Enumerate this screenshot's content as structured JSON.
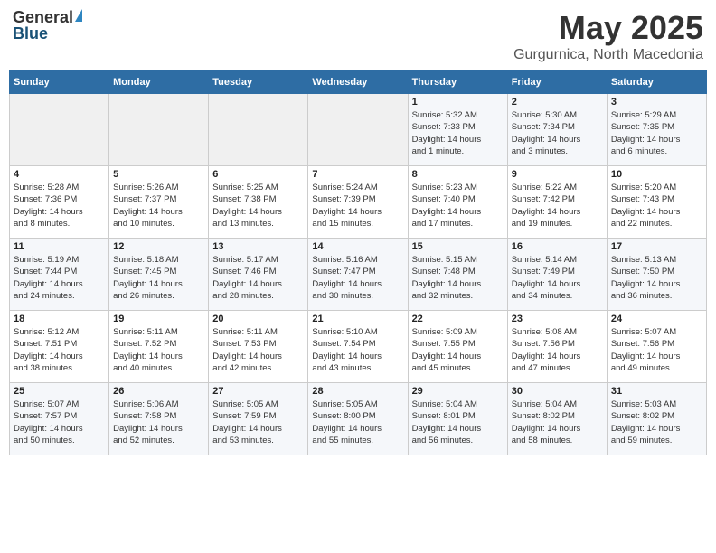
{
  "header": {
    "logo_general": "General",
    "logo_blue": "Blue",
    "title": "May 2025",
    "subtitle": "Gurgurnica, North Macedonia"
  },
  "days_of_week": [
    "Sunday",
    "Monday",
    "Tuesday",
    "Wednesday",
    "Thursday",
    "Friday",
    "Saturday"
  ],
  "weeks": [
    [
      {
        "day": "",
        "detail": ""
      },
      {
        "day": "",
        "detail": ""
      },
      {
        "day": "",
        "detail": ""
      },
      {
        "day": "",
        "detail": ""
      },
      {
        "day": "1",
        "detail": "Sunrise: 5:32 AM\nSunset: 7:33 PM\nDaylight: 14 hours\nand 1 minute."
      },
      {
        "day": "2",
        "detail": "Sunrise: 5:30 AM\nSunset: 7:34 PM\nDaylight: 14 hours\nand 3 minutes."
      },
      {
        "day": "3",
        "detail": "Sunrise: 5:29 AM\nSunset: 7:35 PM\nDaylight: 14 hours\nand 6 minutes."
      }
    ],
    [
      {
        "day": "4",
        "detail": "Sunrise: 5:28 AM\nSunset: 7:36 PM\nDaylight: 14 hours\nand 8 minutes."
      },
      {
        "day": "5",
        "detail": "Sunrise: 5:26 AM\nSunset: 7:37 PM\nDaylight: 14 hours\nand 10 minutes."
      },
      {
        "day": "6",
        "detail": "Sunrise: 5:25 AM\nSunset: 7:38 PM\nDaylight: 14 hours\nand 13 minutes."
      },
      {
        "day": "7",
        "detail": "Sunrise: 5:24 AM\nSunset: 7:39 PM\nDaylight: 14 hours\nand 15 minutes."
      },
      {
        "day": "8",
        "detail": "Sunrise: 5:23 AM\nSunset: 7:40 PM\nDaylight: 14 hours\nand 17 minutes."
      },
      {
        "day": "9",
        "detail": "Sunrise: 5:22 AM\nSunset: 7:42 PM\nDaylight: 14 hours\nand 19 minutes."
      },
      {
        "day": "10",
        "detail": "Sunrise: 5:20 AM\nSunset: 7:43 PM\nDaylight: 14 hours\nand 22 minutes."
      }
    ],
    [
      {
        "day": "11",
        "detail": "Sunrise: 5:19 AM\nSunset: 7:44 PM\nDaylight: 14 hours\nand 24 minutes."
      },
      {
        "day": "12",
        "detail": "Sunrise: 5:18 AM\nSunset: 7:45 PM\nDaylight: 14 hours\nand 26 minutes."
      },
      {
        "day": "13",
        "detail": "Sunrise: 5:17 AM\nSunset: 7:46 PM\nDaylight: 14 hours\nand 28 minutes."
      },
      {
        "day": "14",
        "detail": "Sunrise: 5:16 AM\nSunset: 7:47 PM\nDaylight: 14 hours\nand 30 minutes."
      },
      {
        "day": "15",
        "detail": "Sunrise: 5:15 AM\nSunset: 7:48 PM\nDaylight: 14 hours\nand 32 minutes."
      },
      {
        "day": "16",
        "detail": "Sunrise: 5:14 AM\nSunset: 7:49 PM\nDaylight: 14 hours\nand 34 minutes."
      },
      {
        "day": "17",
        "detail": "Sunrise: 5:13 AM\nSunset: 7:50 PM\nDaylight: 14 hours\nand 36 minutes."
      }
    ],
    [
      {
        "day": "18",
        "detail": "Sunrise: 5:12 AM\nSunset: 7:51 PM\nDaylight: 14 hours\nand 38 minutes."
      },
      {
        "day": "19",
        "detail": "Sunrise: 5:11 AM\nSunset: 7:52 PM\nDaylight: 14 hours\nand 40 minutes."
      },
      {
        "day": "20",
        "detail": "Sunrise: 5:11 AM\nSunset: 7:53 PM\nDaylight: 14 hours\nand 42 minutes."
      },
      {
        "day": "21",
        "detail": "Sunrise: 5:10 AM\nSunset: 7:54 PM\nDaylight: 14 hours\nand 43 minutes."
      },
      {
        "day": "22",
        "detail": "Sunrise: 5:09 AM\nSunset: 7:55 PM\nDaylight: 14 hours\nand 45 minutes."
      },
      {
        "day": "23",
        "detail": "Sunrise: 5:08 AM\nSunset: 7:56 PM\nDaylight: 14 hours\nand 47 minutes."
      },
      {
        "day": "24",
        "detail": "Sunrise: 5:07 AM\nSunset: 7:56 PM\nDaylight: 14 hours\nand 49 minutes."
      }
    ],
    [
      {
        "day": "25",
        "detail": "Sunrise: 5:07 AM\nSunset: 7:57 PM\nDaylight: 14 hours\nand 50 minutes."
      },
      {
        "day": "26",
        "detail": "Sunrise: 5:06 AM\nSunset: 7:58 PM\nDaylight: 14 hours\nand 52 minutes."
      },
      {
        "day": "27",
        "detail": "Sunrise: 5:05 AM\nSunset: 7:59 PM\nDaylight: 14 hours\nand 53 minutes."
      },
      {
        "day": "28",
        "detail": "Sunrise: 5:05 AM\nSunset: 8:00 PM\nDaylight: 14 hours\nand 55 minutes."
      },
      {
        "day": "29",
        "detail": "Sunrise: 5:04 AM\nSunset: 8:01 PM\nDaylight: 14 hours\nand 56 minutes."
      },
      {
        "day": "30",
        "detail": "Sunrise: 5:04 AM\nSunset: 8:02 PM\nDaylight: 14 hours\nand 58 minutes."
      },
      {
        "day": "31",
        "detail": "Sunrise: 5:03 AM\nSunset: 8:02 PM\nDaylight: 14 hours\nand 59 minutes."
      }
    ]
  ]
}
